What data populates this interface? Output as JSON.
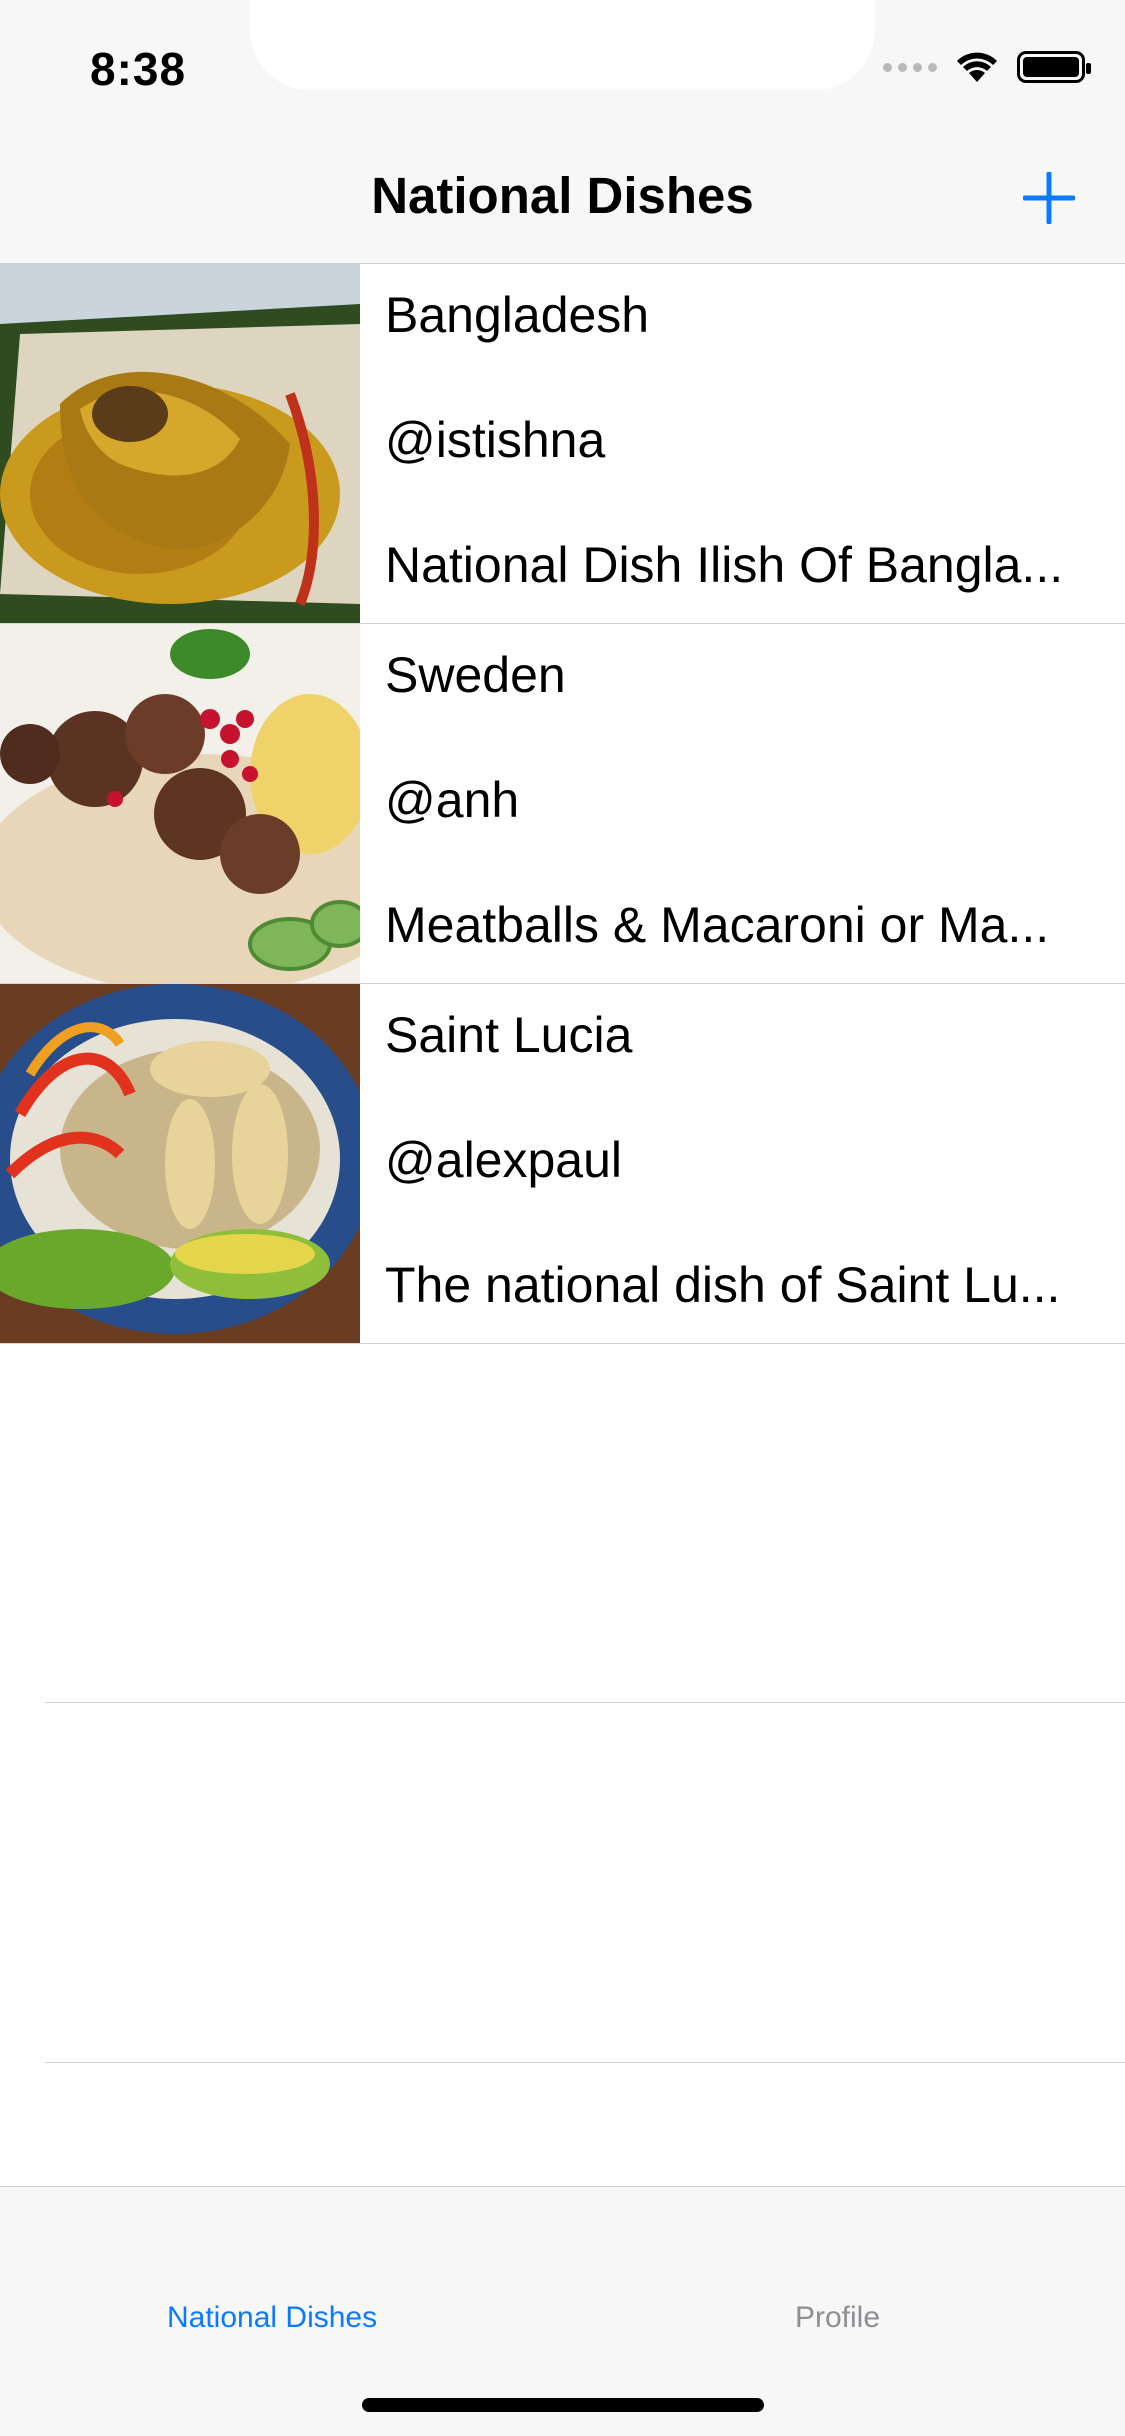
{
  "status_bar": {
    "time": "8:38"
  },
  "nav": {
    "title": "National Dishes"
  },
  "dishes": [
    {
      "country": "Bangladesh",
      "user": "@istishna",
      "description": "National Dish Ilish Of Bangla..."
    },
    {
      "country": "Sweden",
      "user": "@anh",
      "description": "Meatballs & Macaroni or Ma..."
    },
    {
      "country": "Saint Lucia",
      "user": "@alexpaul",
      "description": "The national dish of Saint Lu..."
    }
  ],
  "tabs": [
    {
      "label": "National Dishes",
      "selected": true
    },
    {
      "label": "Profile",
      "selected": false
    }
  ],
  "colors": {
    "accent": "#0a7aff",
    "inactive_tab": "#8e8e93",
    "bar_background": "#f7f7f7"
  }
}
